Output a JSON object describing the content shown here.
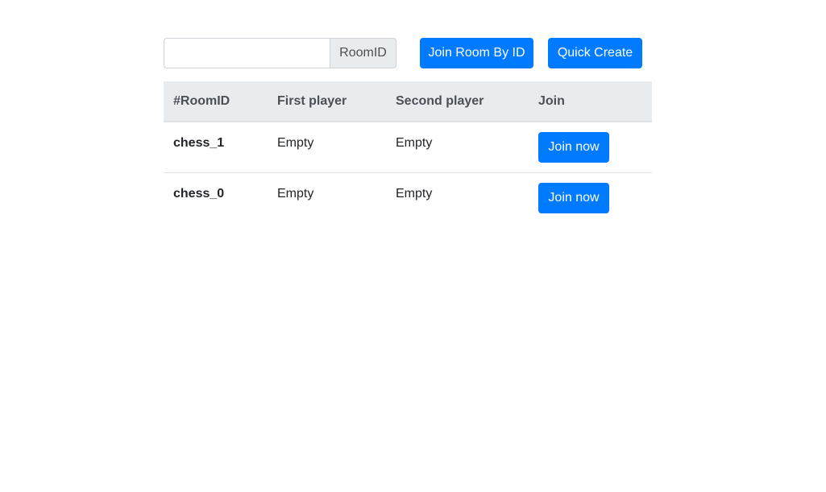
{
  "toolbar": {
    "room_input_value": "",
    "room_input_placeholder": "",
    "room_addon_label": "RoomID",
    "join_by_id_label": "Join Room By ID",
    "quick_create_label": "Quick Create"
  },
  "table": {
    "headers": [
      "#RoomID",
      "First player",
      "Second player",
      "Join"
    ],
    "rows": [
      {
        "room_id": "chess_1",
        "first_player": "Empty",
        "second_player": "Empty",
        "join_label": "Join now"
      },
      {
        "room_id": "chess_0",
        "first_player": "Empty",
        "second_player": "Empty",
        "join_label": "Join now"
      }
    ]
  },
  "colors": {
    "primary": "#007bff",
    "header_bg": "#e9ecef",
    "border": "#dee2e6"
  }
}
